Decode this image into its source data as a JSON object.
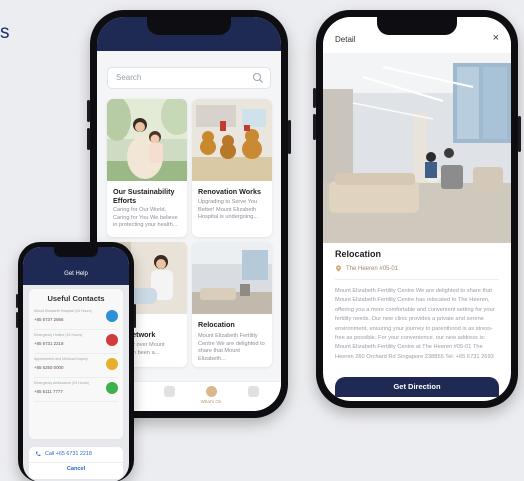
{
  "edge_text": "s",
  "feed": {
    "search_placeholder": "Search",
    "cards": [
      {
        "title": "Our Sustainability Efforts",
        "desc": "Caring for Our World, Caring for You We believe in protecting your health..."
      },
      {
        "title": "Renovation Works",
        "desc": "Upgrading to Serve You Better! Mount Elizabeth Hospital is undergoing..."
      },
      {
        "title": "ical Network",
        "desc": "Care For over Mount Elizabeth been a..."
      },
      {
        "title": "Relocation",
        "desc": "Mount Elizabeth Fertility Centre We are delighted to share that Mount Elizabeth..."
      }
    ],
    "tabs": [
      "",
      "",
      "What's On",
      ""
    ]
  },
  "detail": {
    "header": "Detail",
    "close": "×",
    "title": "Relocation",
    "location": "The Heeren #05-01",
    "body": "Mount Elizabeth Fertility Centre We are delighted to share that Mount Elizabeth Fertility Centre has relocated to The Heeren, offering you a more comfortable and convenient setting for your fertility needs. Our new clinic provides a private and serene environment, ensuring your journey to parenthood is as stress-free as possible. For your convenience, our new address is: Mount Elizabeth Fertility Centre at The Heeren #05-01 The Heeren 260 Orchard Rd Singapore 238855 Tel: +65 6731 2693",
    "button": "Get Direction"
  },
  "help": {
    "header": "Get Help",
    "list_title": "Useful Contacts",
    "contacts": [
      {
        "label": "Mount Elizabeth Hospital (24 Hours)",
        "number": "+65 6737 2666",
        "color": "#2f8fd6"
      },
      {
        "label": "Emergency Hotline (24 Hours)",
        "number": "+65 6731 2218",
        "color": "#d23b3b"
      },
      {
        "label": "Appointment and Medical Enquiry",
        "number": "+65 6250 0000",
        "color": "#e6b12a"
      },
      {
        "label": "Emergency Ambulance (24 Hours)",
        "number": "+65 6111 7777",
        "color": "#3bb04f"
      }
    ],
    "call_label": "Call +65 6731 2218",
    "cancel_label": "Cancel"
  },
  "colors": {
    "navy": "#1e2a54",
    "accent_link": "#2b68c8",
    "location_gold": "#9a8b76"
  }
}
